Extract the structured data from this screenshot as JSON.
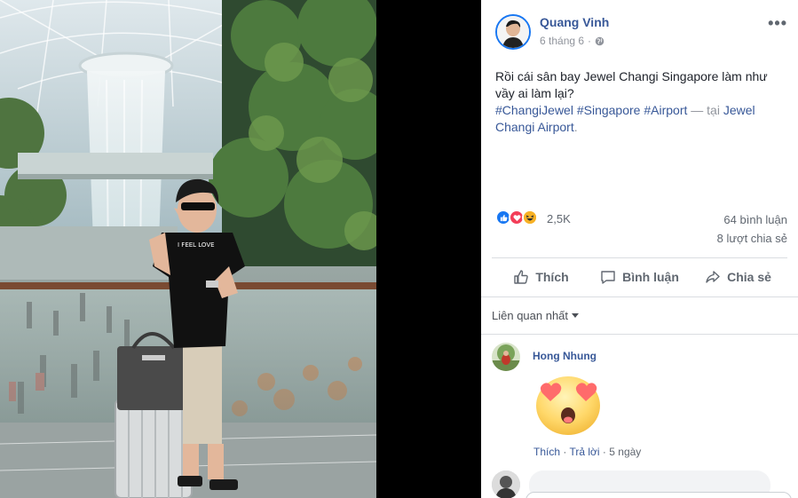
{
  "photo": {
    "alt_name": "post-photo"
  },
  "post": {
    "author": "Quang Vinh",
    "date": "6 tháng 6",
    "privacy_icon": "globe-icon",
    "menu_icon": "more-options-icon",
    "text": "Rồi cái sân bay Jewel Changi Singapore làm như vầy ai làm lại?",
    "hashtags": [
      "#ChangiJewel",
      "#Singapore",
      "#Airport"
    ],
    "location_prefix": "— tại",
    "location": "Jewel Changi Airport",
    "location_suffix": "."
  },
  "stats": {
    "reactions": "2,5K",
    "comments": "64 bình luận",
    "shares": "8 lượt chia sẻ",
    "reaction_icons": [
      "like-icon",
      "love-icon",
      "haha-icon"
    ]
  },
  "actions": {
    "like": "Thích",
    "comment": "Bình luận",
    "share": "Chia sẻ"
  },
  "comments_sort": {
    "label": "Liên quan nhất"
  },
  "comments": [
    {
      "name": "Hong Nhung",
      "sticker": "heart-eyes-emoji-sticker",
      "like": "Thích",
      "sep1": "·",
      "reply": "Trả lời",
      "sep2": "·",
      "time": "5 ngày"
    }
  ],
  "colors": {
    "link": "#385898",
    "accent": "#1877f2",
    "muted": "#90949c"
  }
}
